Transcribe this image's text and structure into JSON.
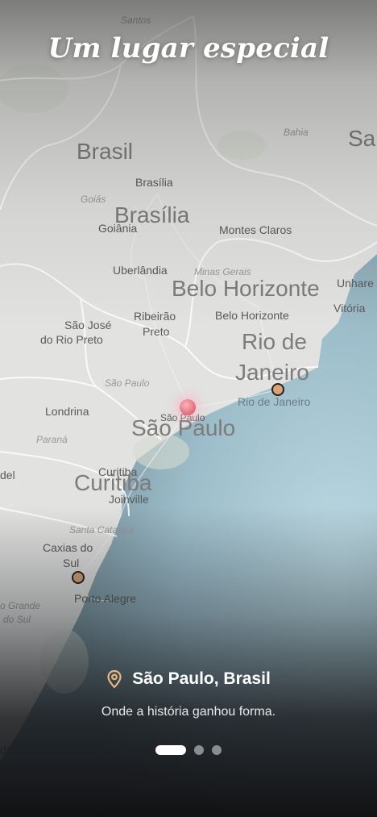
{
  "header": {
    "title": "Um lugar especial"
  },
  "map": {
    "labels": {
      "santos": "Santos",
      "bahia": "Bahia",
      "sa": "Sa",
      "brasil": "Brasil",
      "brasilia_city": "Brasília",
      "goias": "Goiás",
      "brasilia_big": "Brasília",
      "goiania": "Goiânia",
      "montes_claros": "Montes Claros",
      "uberlandia": "Uberlândia",
      "minas_gerais": "Minas Gerais",
      "belo_horizonte_big": "Belo Horizonte",
      "unhare": "Unhare",
      "sao_jose_1": "São José",
      "sao_jose_2": "do Rio Preto",
      "ribeirao_1": "Ribeirão",
      "ribeirao_2": "Preto",
      "belo_horizonte_city": "Belo Horizonte",
      "vitoria": "Vitória",
      "rio_big_1": "Rio de",
      "rio_big_2": "Janeiro",
      "sao_paulo_state": "São Paulo",
      "londrina": "Londrina",
      "rio_city": "Rio de Janeiro",
      "sao_paulo_city": "São Paulo",
      "sao_paulo_big": "São Paulo",
      "parana": "Paraná",
      "curitiba_city": "Curitiba",
      "del": "del",
      "curitiba_big": "Curitiba",
      "joinville": "Joinville",
      "santa_catarina": "Santa Catarina",
      "caxias_1": "Caxias do",
      "caxias_2": "Sul",
      "grande_1": "o Grande",
      "grande_2": "do Sul",
      "porto_alegre": "Porto Alegre",
      "deo": "deo"
    }
  },
  "location": {
    "name": "São Paulo, Brasil",
    "description": "Onde a história ganhou forma."
  },
  "pagination": {
    "pages": 3,
    "current": 1
  },
  "colors": {
    "pin_icon": "#e7b980",
    "pin_fill": "#d9a47a",
    "active_pin": "#e87886",
    "ocean": "#a9c7d3",
    "land": "#e3e3e1"
  }
}
